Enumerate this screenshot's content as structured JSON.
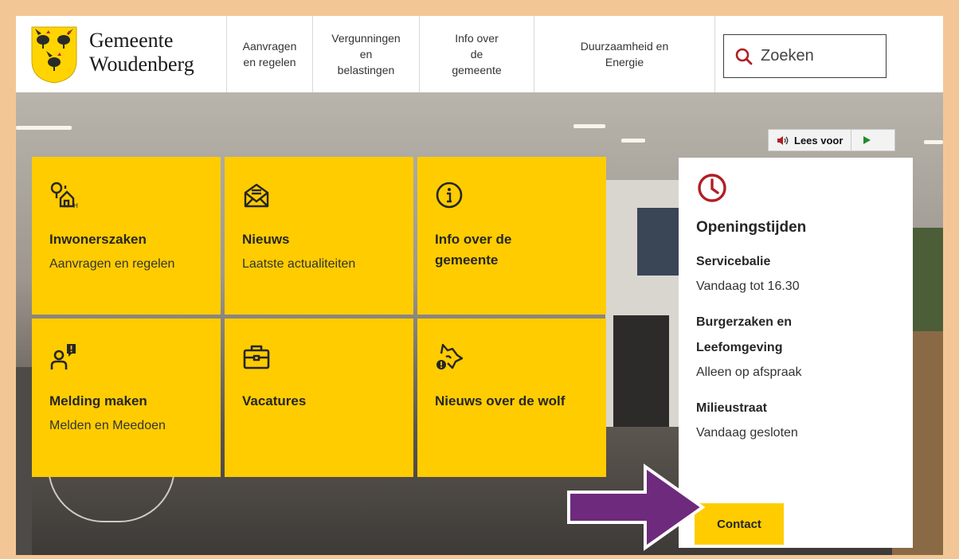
{
  "logo": {
    "line1": "Gemeente",
    "line2": "Woudenberg",
    "icon": "coat-of-arms-roosters"
  },
  "nav": [
    {
      "label": "Aanvragen\nen regelen"
    },
    {
      "label": "Vergunningen\nen\nbelastingen"
    },
    {
      "label": "Info over\nde\ngemeente"
    },
    {
      "label": "Duurzaamheid en\nEnergie"
    }
  ],
  "search": {
    "label": "Zoeken",
    "icon": "search-icon"
  },
  "lees_voor": {
    "label": "Lees voor",
    "icon": "speaker-icon",
    "play_icon": "play-icon"
  },
  "tiles": [
    {
      "icon": "house-tree-icon",
      "title": "Inwonerszaken",
      "subtitle": "Aanvragen en regelen"
    },
    {
      "icon": "envelope-icon",
      "title": "Nieuws",
      "subtitle": "Laatste actualiteiten"
    },
    {
      "icon": "info-icon",
      "title": "Info over de\ngemeente",
      "subtitle": ""
    },
    {
      "icon": "person-alert-icon",
      "title": "Melding maken",
      "subtitle": "Melden en Meedoen"
    },
    {
      "icon": "briefcase-icon",
      "title": "Vacatures",
      "subtitle": ""
    },
    {
      "icon": "wolf-icon",
      "title": "Nieuws over de wolf",
      "subtitle": ""
    }
  ],
  "hours": {
    "title": "Openingstijden",
    "sections": [
      {
        "title": "Servicebalie",
        "text": "Vandaag tot 16.30"
      },
      {
        "title": "Burgerzaken en\nLeefomgeving",
        "text": "Alleen op afspraak"
      },
      {
        "title": "Milieustraat",
        "text": "Vandaag gesloten"
      }
    ],
    "contact_label": "Contact"
  },
  "colors": {
    "accent": "#ffcc00",
    "brand_red": "#b01f24",
    "arrow": "#6e2a7d",
    "frame": "#f3c795"
  }
}
